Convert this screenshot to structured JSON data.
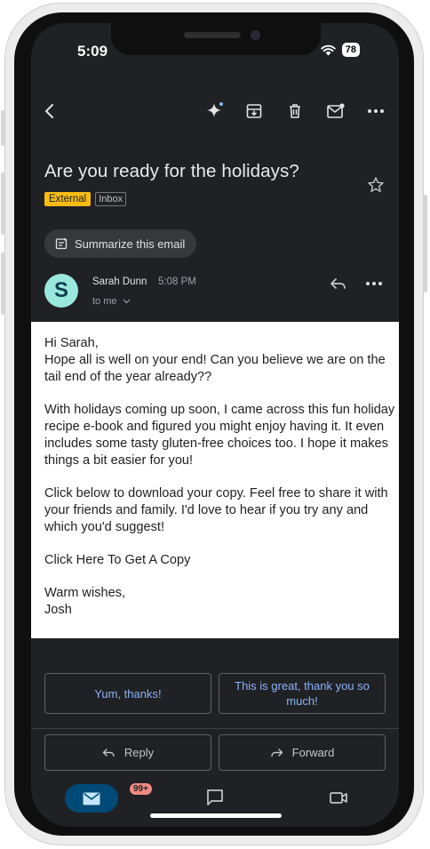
{
  "status": {
    "time": "5:09",
    "battery": "78"
  },
  "toolbar": {
    "back_icon": "arrow-left-icon",
    "gemini_icon": "sparkle-icon",
    "archive_icon": "archive-icon",
    "delete_icon": "trash-icon",
    "mark_unread_icon": "mail-unread-icon",
    "more_icon": "more-horizontal-icon"
  },
  "email": {
    "subject": "Are you ready for the holidays?",
    "labels": {
      "external": "External",
      "inbox": "Inbox"
    },
    "summarize_label": "Summarize this email",
    "sender": {
      "initial": "S",
      "name": "Sarah Dunn",
      "time": "5:08 PM",
      "to": "to me"
    },
    "body": {
      "greeting": "Hi Sarah,",
      "p1": "Hope all is well on your end! Can you believe we are on the tail end of the year already??",
      "p2": "With holidays coming up soon, I came across this fun holiday recipe e-book and figured you might enjoy having it. It even includes some tasty gluten-free choices too. I hope it makes things a bit easier for you!",
      "p3": "Click below to download your copy. Feel free to share it with your friends and family. I'd love to hear if you try any and which you'd suggest!",
      "link": "Click Here To Get A Copy",
      "closing": "Warm wishes,",
      "signature": "Josh"
    }
  },
  "smart_replies": [
    "Yum, thanks!",
    "This is great, thank you so much!"
  ],
  "actions": {
    "reply": "Reply",
    "forward": "Forward"
  },
  "nav": {
    "mail_badge": "99+"
  },
  "colors": {
    "accent": "#8ab4f8",
    "external_label": "#f9bc14",
    "avatar": "#9ae8dd",
    "nav_active": "#004a77"
  }
}
